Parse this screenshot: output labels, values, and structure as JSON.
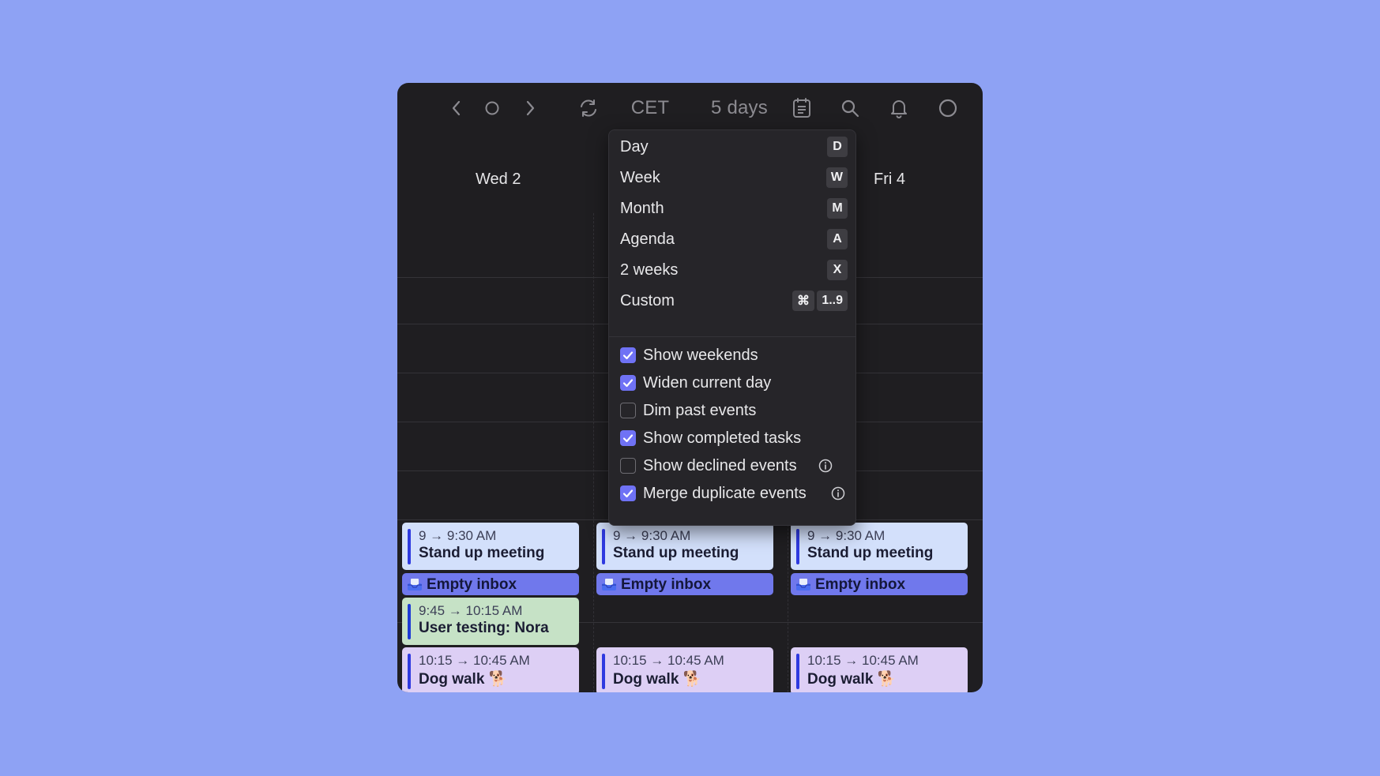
{
  "toolbar": {
    "timezone": "CET",
    "view": "5 days"
  },
  "days": [
    {
      "label": "Wed 2"
    },
    {
      "label": "Fri 4"
    }
  ],
  "events": {
    "standup": {
      "time": "9 → 9:30 AM",
      "title": "Stand up meeting"
    },
    "task": {
      "title": "Empty inbox"
    },
    "testing": {
      "time": "9:45 → 10:15 AM",
      "title": "User testing: Nora"
    },
    "dogwalk": {
      "time": "10:15 → 10:45 AM",
      "title": "Dog walk 🐕"
    }
  },
  "menu": {
    "views": [
      {
        "label": "Day",
        "key": "D"
      },
      {
        "label": "Week",
        "key": "W"
      },
      {
        "label": "Month",
        "key": "M"
      },
      {
        "label": "Agenda",
        "key": "A"
      },
      {
        "label": "2 weeks",
        "key": "X"
      },
      {
        "label": "Custom",
        "key_mod": "⌘",
        "key": "1..9"
      }
    ],
    "options": [
      {
        "label": "Show weekends",
        "checked": true
      },
      {
        "label": "Widen current day",
        "checked": true
      },
      {
        "label": "Dim past events",
        "checked": false
      },
      {
        "label": "Show completed tasks",
        "checked": true
      },
      {
        "label": "Show declined events",
        "checked": false
      },
      {
        "label": "Merge duplicate events",
        "checked": true
      }
    ]
  },
  "colors": {
    "background": "#8ea2f4",
    "window": "#1f1e21",
    "accent": "#6f72f5",
    "event_blue": "#d3e0fb",
    "event_green": "#c6e2c6",
    "event_lilac": "#ddcff5",
    "task": "#7078ec"
  },
  "icons": [
    "chevron-left-icon",
    "today-circle-icon",
    "chevron-right-icon",
    "refresh-icon",
    "calendar-list-icon",
    "search-icon",
    "bell-icon",
    "profile-circle-icon",
    "checkmark-icon",
    "info-icon",
    "inbox-tray-icon"
  ]
}
